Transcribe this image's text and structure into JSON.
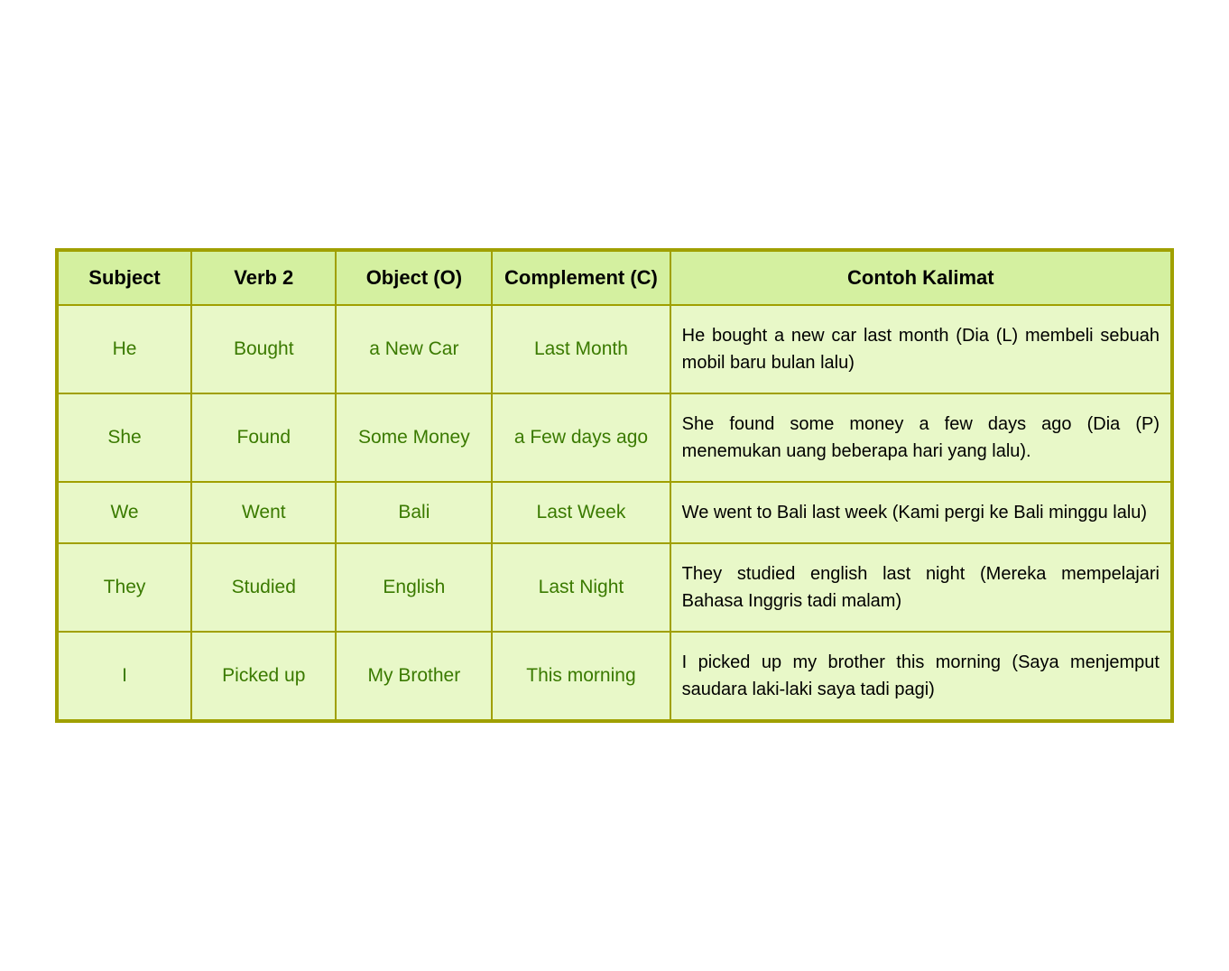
{
  "table": {
    "headers": {
      "subject": "Subject",
      "verb2": "Verb 2",
      "object": "Object (O)",
      "complement": "Complement (C)",
      "contoh": "Contoh Kalimat"
    },
    "rows": [
      {
        "subject": "He",
        "verb2": "Bought",
        "object": "a New Car",
        "complement": "Last Month",
        "contoh": "He bought a new car last month (Dia (L) membeli sebuah mobil baru bulan lalu)"
      },
      {
        "subject": "She",
        "verb2": "Found",
        "object": "Some Money",
        "complement": "a Few days ago",
        "contoh": "She found some money a few days ago (Dia (P) menemukan uang beberapa hari yang lalu)."
      },
      {
        "subject": "We",
        "verb2": "Went",
        "object": "Bali",
        "complement": "Last Week",
        "contoh": "We went to Bali last week (Kami pergi ke Bali minggu lalu)"
      },
      {
        "subject": "They",
        "verb2": "Studied",
        "object": "English",
        "complement": "Last Night",
        "contoh": "They studied english last night (Mereka mempelajari Bahasa Inggris tadi malam)"
      },
      {
        "subject": "I",
        "verb2": "Picked up",
        "object": "My Brother",
        "complement": "This morning",
        "contoh": "I picked up my brother this morning (Saya menjemput saudara laki-laki saya tadi pagi)"
      }
    ]
  }
}
